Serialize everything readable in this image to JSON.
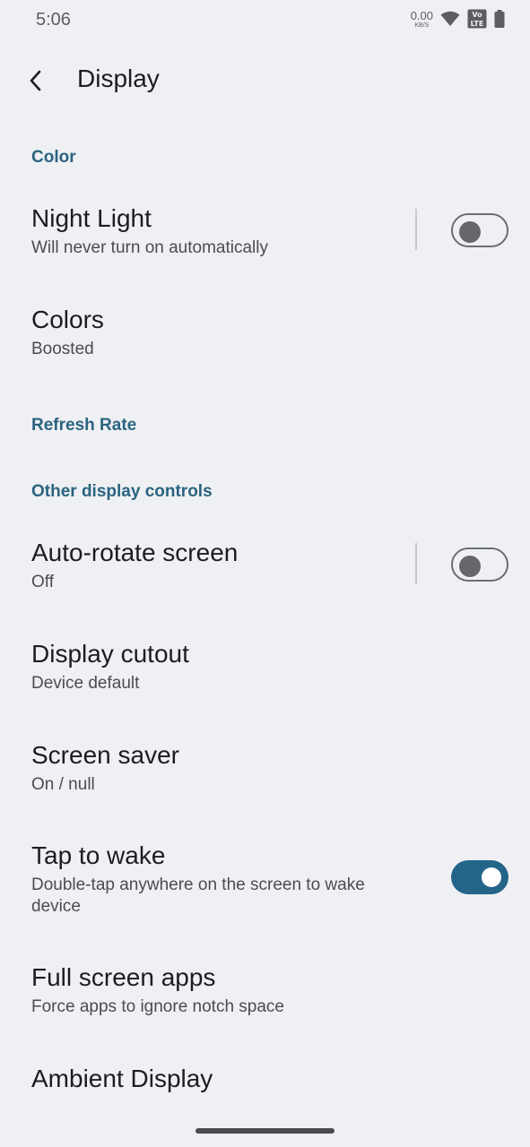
{
  "status_bar": {
    "time": "5:06",
    "net_speed_value": "0.00",
    "net_speed_unit": "KB/S",
    "icons": [
      "wifi-icon",
      "volte-icon",
      "battery-icon"
    ]
  },
  "app_bar": {
    "title": "Display",
    "back_icon": "back-arrow-icon"
  },
  "sections": {
    "color": "Color",
    "refresh_rate": "Refresh Rate",
    "other": "Other display controls"
  },
  "prefs": {
    "night_light": {
      "title": "Night Light",
      "summary": "Will never turn on automatically",
      "enabled": false
    },
    "colors": {
      "title": "Colors",
      "summary": "Boosted"
    },
    "auto_rotate": {
      "title": "Auto-rotate screen",
      "summary": "Off",
      "enabled": false
    },
    "display_cutout": {
      "title": "Display cutout",
      "summary": "Device default"
    },
    "screen_saver": {
      "title": "Screen saver",
      "summary": "On / null"
    },
    "tap_to_wake": {
      "title": "Tap to wake",
      "summary": "Double-tap anywhere on the screen to wake device",
      "enabled": true
    },
    "full_screen_apps": {
      "title": "Full screen apps",
      "summary": "Force apps to ignore notch space"
    },
    "ambient_display": {
      "title": "Ambient Display"
    }
  },
  "colors": {
    "accent": "#236489",
    "section_header": "#2a6480",
    "background": "#eff0f3"
  }
}
